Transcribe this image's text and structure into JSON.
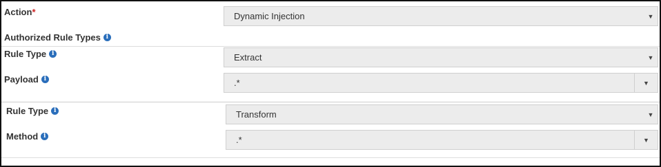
{
  "action": {
    "label": "Action",
    "required_mark": "*",
    "value": "Dynamic Injection"
  },
  "authorized_rule_types": {
    "heading": "Authorized Rule Types"
  },
  "rules": [
    {
      "rule_type_label": "Rule Type",
      "rule_type_value": "Extract",
      "second_label": "Payload",
      "second_value": ".*"
    },
    {
      "rule_type_label": "Rule Type",
      "rule_type_value": "Transform",
      "second_label": "Method",
      "second_value": ".*"
    }
  ],
  "icons": {
    "info": "info-icon",
    "caret": "caret-down-icon",
    "info_glyph": "i",
    "caret_glyph": "▼"
  },
  "colors": {
    "required": "#cc2222",
    "info_icon": "#2a6ebb",
    "field_background": "#ececec"
  }
}
